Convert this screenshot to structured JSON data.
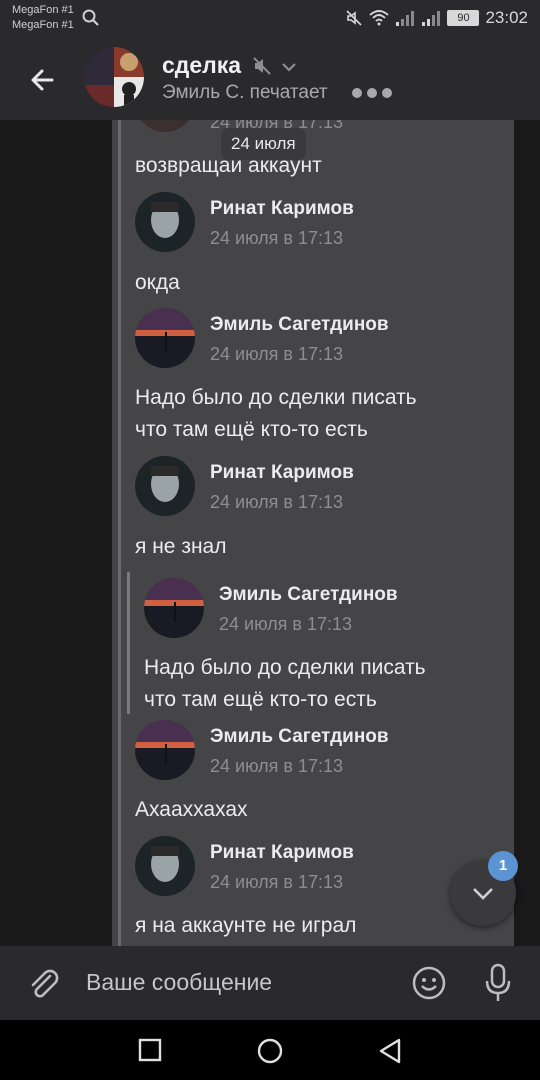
{
  "status_bar": {
    "carrier1": "MegaFon #1",
    "carrier2": "MegaFon #1",
    "battery": "90",
    "time": "23:02"
  },
  "header": {
    "title": "сделка",
    "subtitle": "Эмиль С. печатает"
  },
  "date_pill": "24 июля",
  "messages": [
    {
      "name": "",
      "time": "24 июля в 17:13",
      "text": "возвращай аккаунт"
    },
    {
      "name": "Ринат Каримов",
      "time": "24 июля в 17:13",
      "text": "окда"
    },
    {
      "name": "Эмиль Сагетдинов",
      "time": "24 июля в 17:13",
      "text_lines": [
        "Надо было до сделки писать",
        "что там ещё кто-то есть"
      ]
    },
    {
      "name": "Ринат Каримов",
      "time": "24 июля в 17:13",
      "text": "я не знал"
    },
    {
      "reply": {
        "name": "Эмиль Сагетдинов",
        "time": "24 июля в 17:13",
        "text_lines": [
          "Надо было до сделки писать",
          "что там ещё кто-то есть"
        ]
      }
    },
    {
      "name": "Эмиль Сагетдинов",
      "time": "24 июля в 17:13",
      "text": "Ахааххахах"
    },
    {
      "name": "Ринат Каримов",
      "time": "24 июля в 17:13",
      "text": "я на аккаунте не играл"
    }
  ],
  "scroll_badge": "1",
  "composer": {
    "placeholder": "Ваше сообщение"
  },
  "colors": {
    "background": "#19191a",
    "forward_panel": "#454547",
    "accent_badge": "#5b93d4"
  },
  "icons": [
    "search-icon",
    "mute-icon",
    "wifi-icon",
    "signal-icon",
    "battery-icon",
    "back-arrow-icon",
    "muted-speaker-icon",
    "chevron-down-icon",
    "typing-dots-icon",
    "attach-icon",
    "emoji-icon",
    "microphone-icon",
    "nav-square-icon",
    "nav-circle-icon",
    "nav-back-triangle-icon"
  ]
}
